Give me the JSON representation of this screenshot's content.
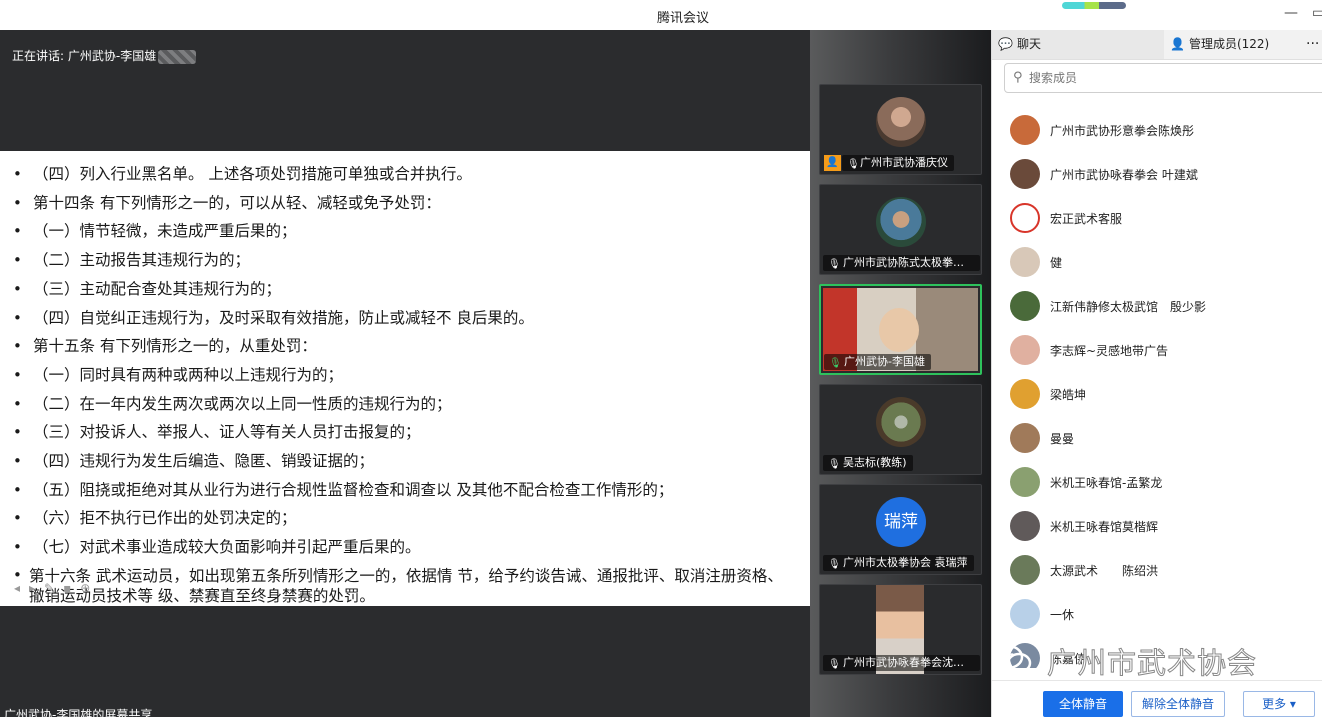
{
  "window": {
    "title": "腾讯会议",
    "minimize_glyph": "—",
    "maximize_glyph": "▭"
  },
  "share": {
    "speaker_prefix": "正在讲话:",
    "speaker_name": "广州武协-李国雄",
    "screen_share_label": "广州武协-李国雄的屏幕共享",
    "slide_lines": [
      "（四）列入行业黑名单。 上述各项处罚措施可单独或合并执行。",
      "第十四条 有下列情形之一的，可以从轻、减轻或免予处罚：",
      "（一）情节轻微，未造成严重后果的；",
      "（二）主动报告其违规行为的；",
      " （三）主动配合查处其违规行为的；",
      "（四）自觉纠正违规行为，及时采取有效措施，防止或减轻不 良后果的。",
      "第十五条 有下列情形之一的，从重处罚：",
      "（一）同时具有两种或两种以上违规行为的；",
      "（二）在一年内发生两次或两次以上同一性质的违规行为的；",
      "（三）对投诉人、举报人、证人等有关人员打击报复的；",
      "（四）违规行为发生后编造、隐匿、销毁证据的；",
      "（五）阻挠或拒绝对其从业行为进行合规性监督检查和调查以 及其他不配合检查工作情形的；",
      "（六）拒不执行已作出的处罚决定的；",
      " （七）对武术事业造成较大负面影响并引起严重后果的。"
    ],
    "slide_last": "第十六条 武术运动员，如出现第五条所列情形之一的，依据情 节，给予约谈告诫、通报批评、取消注册资格、撤销运动员技术等 级、禁赛直至终身禁赛的处罚。"
  },
  "videos": [
    {
      "name": "广州市武协潘庆仪",
      "avatar_color": "#8a6b5a",
      "host": true,
      "active": false
    },
    {
      "name": "广州市武协陈式太极拳会...",
      "avatar_color": "#6a8a7a",
      "host": false,
      "active": false
    },
    {
      "name": "广州武协-李国雄",
      "avatar_color": "#c9b7a0",
      "host": false,
      "active": true
    },
    {
      "name": "吴志标(教练)",
      "avatar_color": "#7a6a50",
      "host": false,
      "active": false
    },
    {
      "name": "广州市太极拳协会 袁瑞萍",
      "avatar_color": "#1f6fe0",
      "host": false,
      "active": false,
      "initials": "瑞萍"
    },
    {
      "name": "广州市武协咏春拳会沈伟华",
      "avatar_color": "#b89a80",
      "host": false,
      "active": false
    }
  ],
  "panel": {
    "tab_chat": "聊天",
    "tab_members": "管理成员(122)",
    "more_glyph": "···",
    "search_placeholder": "搜索成员",
    "members": [
      {
        "name": "广州市武协形意拳会陈焕彤",
        "color": "#c86a3a"
      },
      {
        "name": "广州市武协咏春拳会 叶建斌",
        "color": "#6a4a3a"
      },
      {
        "name": "宏正武术客服",
        "color": "#d8352a"
      },
      {
        "name": "健",
        "color": "#d8c8b8"
      },
      {
        "name": "江新伟静修太极武馆　殷少影",
        "color": "#4a6a3a"
      },
      {
        "name": "李志辉~灵感地带广告",
        "color": "#e0b0a0"
      },
      {
        "name": "梁皓坤",
        "color": "#e0a030"
      },
      {
        "name": "曼曼",
        "color": "#a07a5a"
      },
      {
        "name": "米机王咏春馆-孟繁龙",
        "color": "#8aa070"
      },
      {
        "name": "米机王咏春馆莫楷辉",
        "color": "#605a5a"
      },
      {
        "name": "太源武术　　陈绍洪",
        "color": "#6a7a5a"
      },
      {
        "name": "一休",
        "color": "#b8d0e8"
      },
      {
        "name": "陈嘉伟",
        "color": "#7a8aa0"
      }
    ],
    "mute_all": "全体静音",
    "unmute_all": "解除全体静音",
    "more": "更多 ▾"
  },
  "watermark": {
    "text": "广州市武术协会"
  }
}
